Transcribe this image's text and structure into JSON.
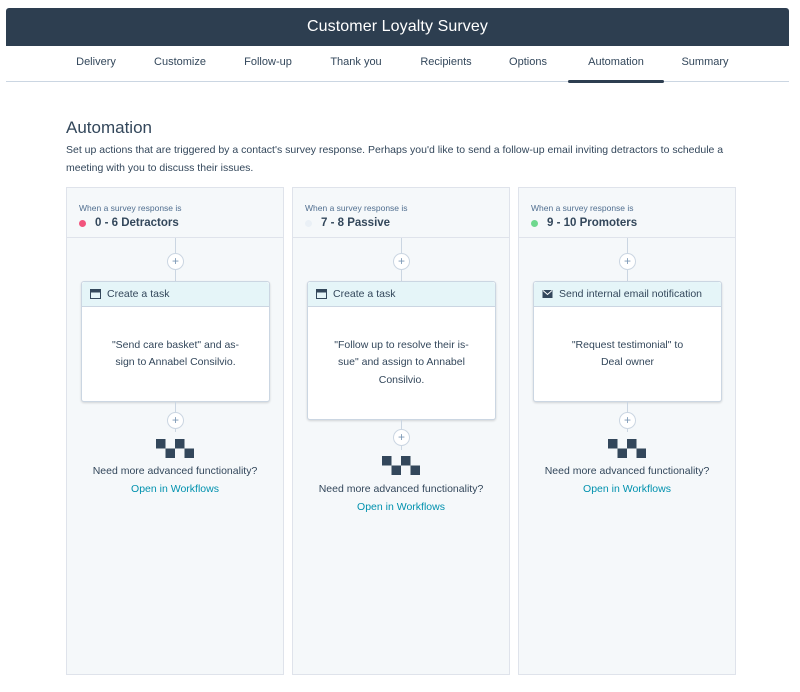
{
  "title": "Customer Loyalty Survey",
  "tabs": [
    "Delivery",
    "Customize",
    "Follow-up",
    "Thank you",
    "Recipients",
    "Options",
    "Automation",
    "Summary"
  ],
  "active_tab": "Automation",
  "section": {
    "title": "Automation",
    "description": "Set up actions that are triggered by a contact's survey response. Perhaps you'd like to send a follow-up email inviting detractors to schedule a meeting with you to discuss their issues."
  },
  "columns": [
    {
      "pre": "When a survey response is",
      "segment": "0 - 6 Detractors",
      "dot_color": "#f2547d",
      "action_icon": "calendar-icon",
      "action_title": "Create a task",
      "action_body": "\"Send care basket\" and as-sign to Annabel Consilvio.",
      "more_text": "Need more advanced functionality?",
      "link_text": "Open in Workflows"
    },
    {
      "pre": "When a survey response is",
      "segment": "7 - 8 Passive",
      "dot_color": "#eaf0f6",
      "action_icon": "calendar-icon",
      "action_title": "Create a task",
      "action_body": "\"Follow up to resolve their is-sue\" and assign to Annabel Consilvio.",
      "more_text": "Need more advanced functionality?",
      "link_text": "Open in Workflows"
    },
    {
      "pre": "When a survey response is",
      "segment": "9 - 10 Promoters",
      "dot_color": "#6fd88e",
      "action_icon": "envelope-icon",
      "action_title": "Send internal email notification",
      "action_body": "\"Request testimonial\" to Deal owner",
      "more_text": "Need more advanced functionality?",
      "link_text": "Open in Workflows"
    }
  ],
  "colors": {
    "header": "#2d3e50",
    "card_header": "#e5f5f8",
    "link": "#0091ae",
    "column_bg": "#f5f8fa"
  }
}
